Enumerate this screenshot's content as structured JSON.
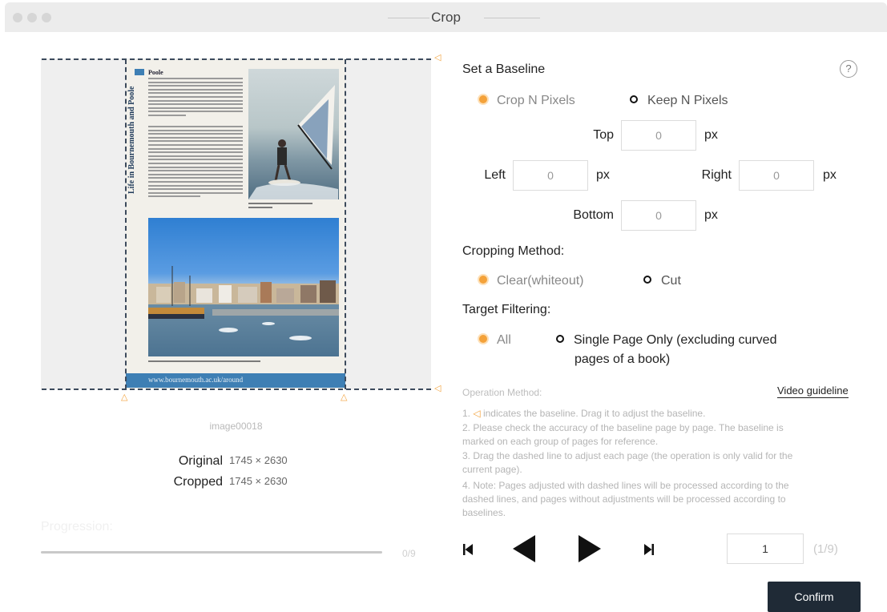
{
  "window": {
    "title": "Crop"
  },
  "preview": {
    "page": {
      "side_title": "Life in Bournemouth and Poole",
      "heading": "Poole",
      "footer_url": "www.bournemouth.ac.uk/around"
    },
    "image_name": "image00018",
    "original_label": "Original",
    "original_value": "1745 × 2630",
    "cropped_label": "Cropped",
    "cropped_value": "1745 × 2630",
    "progress_label": "Progression:",
    "progress_text": "0/9"
  },
  "baseline": {
    "heading": "Set a Baseline",
    "help_icon": "?",
    "mode_crop": "Crop N Pixels",
    "mode_keep": "Keep N Pixels",
    "top_label": "Top",
    "top_value": "0",
    "left_label": "Left",
    "left_value": "0",
    "right_label": "Right",
    "right_value": "0",
    "bottom_label": "Bottom",
    "bottom_value": "0",
    "unit": "px"
  },
  "cropping_method": {
    "heading": "Cropping Method:",
    "clear": "Clear(whiteout)",
    "cut": "Cut"
  },
  "target_filtering": {
    "heading": "Target Filtering:",
    "all": "All",
    "single_line1": "Single Page Only (excluding curved",
    "single_line2": "pages of a book)"
  },
  "operation": {
    "heading": "Operation Method:",
    "video_link": "Video guideline",
    "line1_prefix": "1.",
    "line1_rest": "indicates the baseline. Drag it to adjust the baseline.",
    "line2": "2. Please check the accuracy of the baseline page by page. The baseline is",
    "line3": "marked on each group of pages for reference.",
    "line4": "3. Drag the dashed line to adjust each page (the operation is only valid for the",
    "line5": "current page).",
    "line6": "4. Note: Pages adjusted with dashed lines will be processed according to the",
    "line7": "dashed lines, and pages without adjustments will be processed according to",
    "line8": "baselines."
  },
  "pager": {
    "current": "1",
    "total": "(1/9)"
  },
  "confirm_label": "Confirm"
}
